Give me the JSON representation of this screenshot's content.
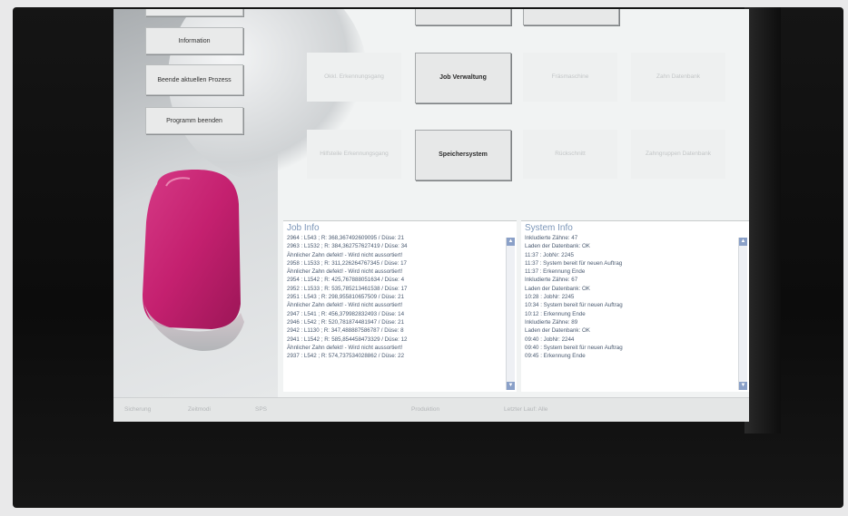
{
  "sidebar": {
    "buttons": [
      {
        "label": ""
      },
      {
        "label": "Information"
      },
      {
        "label": "Beende aktuellen Prozess"
      },
      {
        "label": "Programm beenden"
      }
    ]
  },
  "tiles": [
    {
      "label": ""
    },
    {
      "label": ""
    },
    {
      "label": "Okkl. Erkennungsgang"
    },
    {
      "label": "Job Verwaltung"
    },
    {
      "label": "Fräsmaschine"
    },
    {
      "label": "Zahn Datenbank"
    },
    {
      "label": "Hilfsteile Erkennungsgang"
    },
    {
      "label": "Speichersystem"
    },
    {
      "label": "Rückschnitt"
    },
    {
      "label": "Zahngruppen Datenbank"
    }
  ],
  "job_info": {
    "title": "Job Info",
    "lines": [
      "2964 : L543 ; R: 368,367492609095 / Düse: 21",
      "2963 : L1532 ; R: 384,362757627419 / Düse: 34",
      "Ähnlicher Zahn defekt! - Wird nicht aussortiert!",
      "2958 : L1533 ; R: 311,226264767345 / Düse: 17",
      "Ähnlicher Zahn defekt! - Wird nicht aussortiert!",
      "2954 : L1542 ; R: 425,767888051634 / Düse: 4",
      "2952 : L1533 ; R: 535,785213461538 / Düse: 17",
      "2951 : L543 ; R: 298,955810657509 / Düse: 21",
      "Ähnlicher Zahn defekt! - Wird nicht aussortiert!",
      "2947 : L541 ; R: 456,379982832493 / Düse: 14",
      "2946 : L542 ; R: 520,781874481947 / Düse: 21",
      "2942 : L1130 ; R: 347,488887586787 / Düse: 8",
      "2941 : L1542 ; R: 585,854458473329 / Düse: 12",
      "Ähnlicher Zahn defekt! - Wird nicht aussortiert!",
      "2937 : L542 ; R: 574,737534028862 / Düse: 22"
    ]
  },
  "system_info": {
    "title": "System Info",
    "lines": [
      "Inkludierte Zähne: 47",
      "Laden der Datenbank: OK",
      "11:37 : JobNr: 2245",
      "11:37 : System bereit für neuen Auftrag",
      "11:37 : Erkennung Ende",
      "Inkludierte Zähne: 67",
      "Laden der Datenbank: OK",
      "10:28 : JobNr: 2245",
      "10:34 : System bereit für neuen Auftrag",
      "10:12 : Erkennung Ende",
      "Inkludierte Zähne: 89",
      "Laden der Datenbank: OK",
      "09:40 : JobNr: 2244",
      "09:40 : System bereit für neuen Auftrag",
      "09:45 : Erkennung Ende"
    ]
  },
  "status_bar": {
    "items": [
      "Sicherung",
      "Zeitmodi",
      "SPS",
      "Produktion",
      "Letzter Lauf: Alle"
    ]
  },
  "colors": {
    "crown": "#c4206f",
    "accent_text": "#7c96b8",
    "bezel": "#111111"
  }
}
